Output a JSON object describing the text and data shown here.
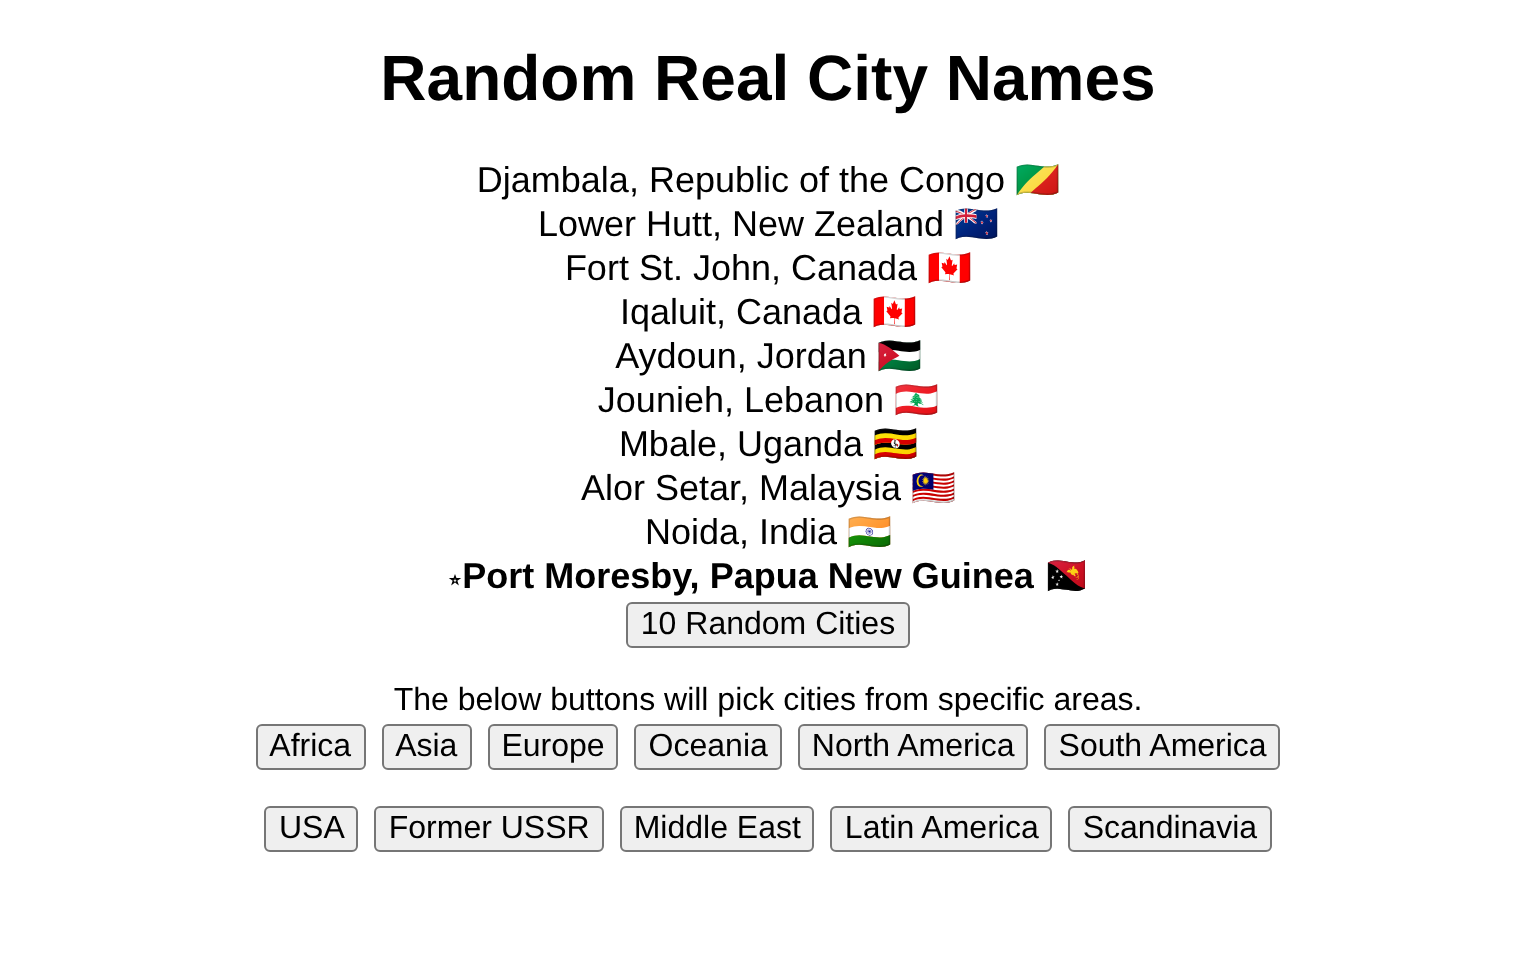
{
  "title": "Random Real City Names",
  "cities": [
    {
      "name": "Djambala, Republic of the Congo",
      "flag": "🇨🇬",
      "selected": false
    },
    {
      "name": "Lower Hutt, New Zealand",
      "flag": "🇳🇿",
      "selected": false
    },
    {
      "name": "Fort St. John, Canada",
      "flag": "🇨🇦",
      "selected": false
    },
    {
      "name": "Iqaluit, Canada",
      "flag": "🇨🇦",
      "selected": false
    },
    {
      "name": "Aydoun, Jordan",
      "flag": "🇯🇴",
      "selected": false
    },
    {
      "name": "Jounieh, Lebanon",
      "flag": "🇱🇧",
      "selected": false
    },
    {
      "name": "Mbale, Uganda",
      "flag": "🇺🇬",
      "selected": false
    },
    {
      "name": "Alor Setar, Malaysia",
      "flag": "🇲🇾",
      "selected": false
    },
    {
      "name": "Noida, India",
      "flag": "🇮🇳",
      "selected": false
    },
    {
      "name": "Port Moresby, Papua New Guinea",
      "flag": "🇵🇬",
      "selected": true,
      "marker": "⭒"
    }
  ],
  "random_button": "10 Random Cities",
  "hint": "The below buttons will pick cities from specific areas.",
  "area_rows": [
    [
      "Africa",
      "Asia",
      "Europe",
      "Oceania",
      "North America",
      "South America"
    ],
    [
      "USA",
      "Former USSR",
      "Middle East",
      "Latin America",
      "Scandinavia"
    ]
  ]
}
